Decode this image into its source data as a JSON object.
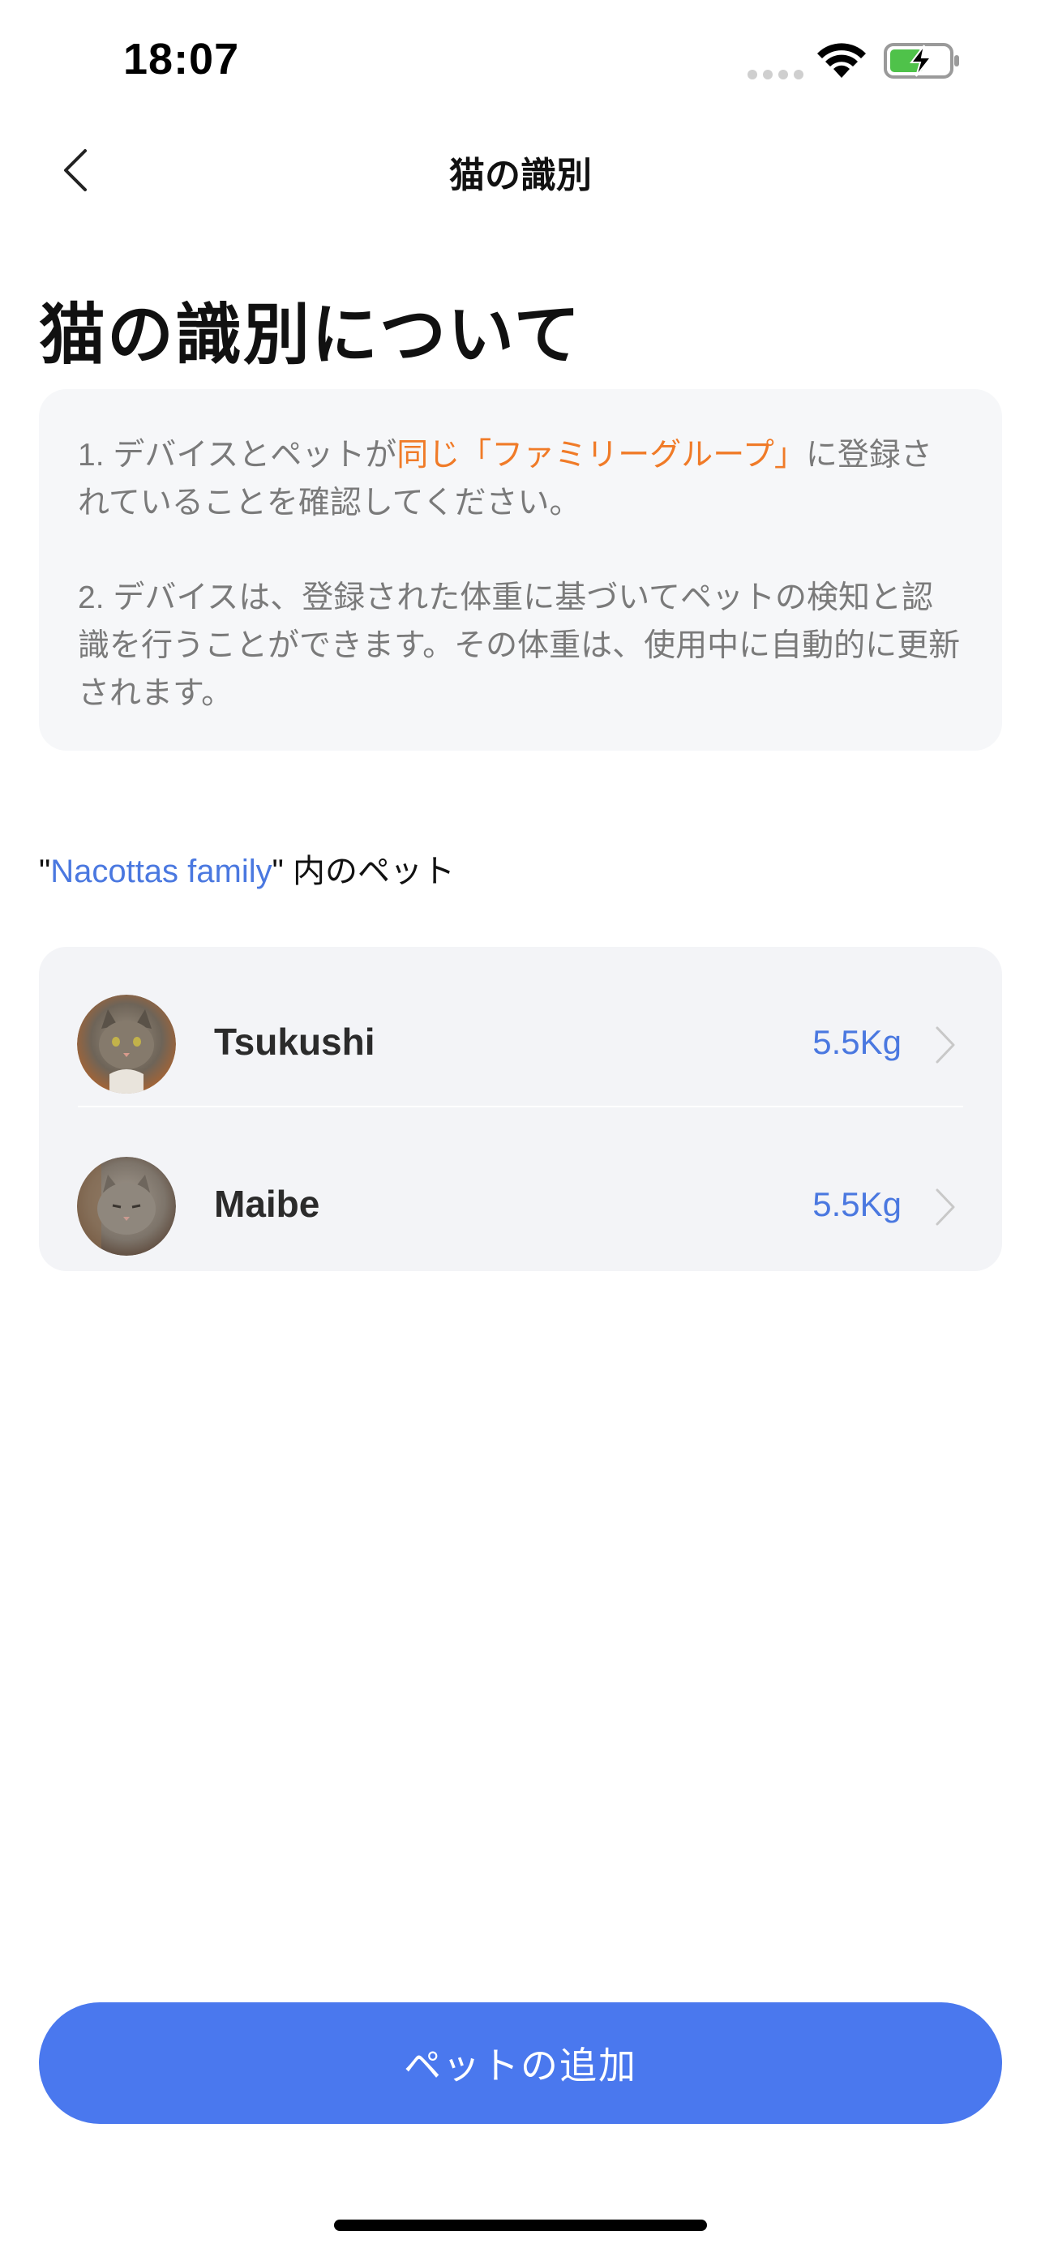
{
  "status_bar": {
    "time": "18:07"
  },
  "nav": {
    "title": "猫の識別",
    "back_icon": "chevron-left-icon"
  },
  "heading": "猫の識別について",
  "info": {
    "para1_prefix": "1. デバイスとペットが",
    "para1_highlight": "同じ「ファミリーグループ」",
    "para1_suffix": "に登録されていることを確認してください。",
    "para2": "2. デバイスは、登録された体重に基づいてペットの検知と認識を行うことができます。その体重は、使用中に自動的に更新されます。"
  },
  "family": {
    "quote_open": "\"",
    "name": "Nacottas family",
    "quote_close": "\"",
    "suffix": " 内のペット"
  },
  "pets": [
    {
      "name": "Tsukushi",
      "weight": "5.5Kg",
      "avatar_icon": "cat-photo"
    },
    {
      "name": "Maibe",
      "weight": "5.5Kg",
      "avatar_icon": "cat-photo"
    }
  ],
  "add_button_label": "ペットの追加",
  "colors": {
    "accent_blue": "#4a78ee",
    "highlight_orange": "#f07b28",
    "card_bg": "#f6f7f9"
  }
}
